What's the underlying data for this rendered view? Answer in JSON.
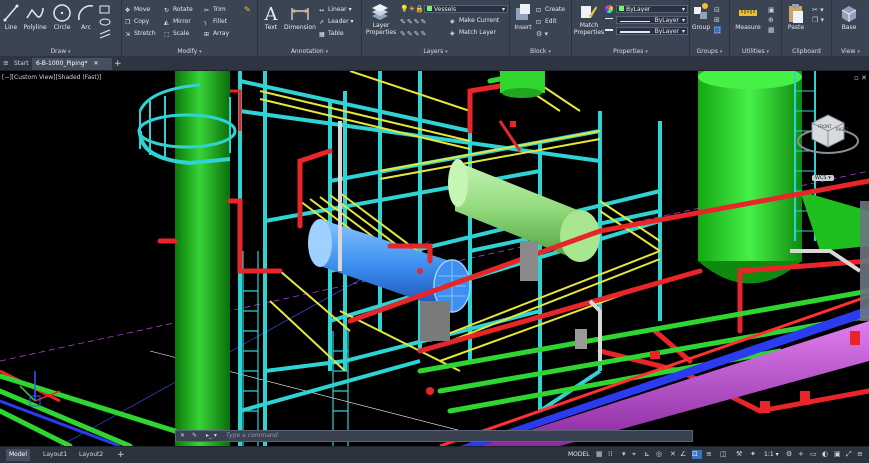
{
  "ribbon": {
    "draw": {
      "title": "Draw",
      "line": "Line",
      "polyline": "Polyline",
      "circle": "Circle",
      "arc": "Arc"
    },
    "modify": {
      "title": "Modify",
      "move": "Move",
      "rotate": "Rotate",
      "trim": "Trim",
      "copy": "Copy",
      "mirror": "Mirror",
      "fillet": "Fillet",
      "stretch": "Stretch",
      "scale": "Scale",
      "array": "Array"
    },
    "annotation": {
      "title": "Annotation",
      "text": "Text",
      "dimension": "Dimension",
      "linear": "Linear",
      "leader": "Leader",
      "table": "Table"
    },
    "layers": {
      "title": "Layers",
      "layer_properties": "Layer Properties",
      "current_layer": "Vessels",
      "make_current": "Make Current",
      "match_layer": "Match Layer"
    },
    "block": {
      "title": "Block",
      "insert": "Insert",
      "create": "Create",
      "edit": "Edit"
    },
    "properties": {
      "title": "Properties",
      "match_properties": "Match Properties",
      "color": "ByLayer",
      "linetype": "ByLayer",
      "lineweight": "ByLayer"
    },
    "groups": {
      "title": "Groups",
      "group": "Group"
    },
    "utilities": {
      "title": "Utilities",
      "measure": "Measure"
    },
    "clipboard": {
      "title": "Clipboard",
      "paste": "Paste"
    },
    "view": {
      "title": "View",
      "base": "Base"
    }
  },
  "tabs": {
    "start": "Start",
    "drawing": "6-B-1000_Piping*"
  },
  "viewport": {
    "label": "[−][Custom View][Shaded (Fast)]",
    "viewcube_face": "FRONT",
    "viewcube_right": "RIGHT",
    "wcs": "WCS"
  },
  "command": {
    "placeholder": "Type a command"
  },
  "layouts": {
    "model": "Model",
    "layout1": "Layout1",
    "layout2": "Layout2"
  },
  "status": {
    "mode": "MODEL",
    "scale": "1:1"
  },
  "colors": {
    "structure": "#2fd3d3",
    "handrail": "#e6e63a",
    "vessel": "#7ef07a",
    "piping_red": "#e8262a",
    "piping_green": "#2fd62f",
    "piping_blue": "#2b3cf0",
    "piping_magenta": "#c43ad6"
  }
}
